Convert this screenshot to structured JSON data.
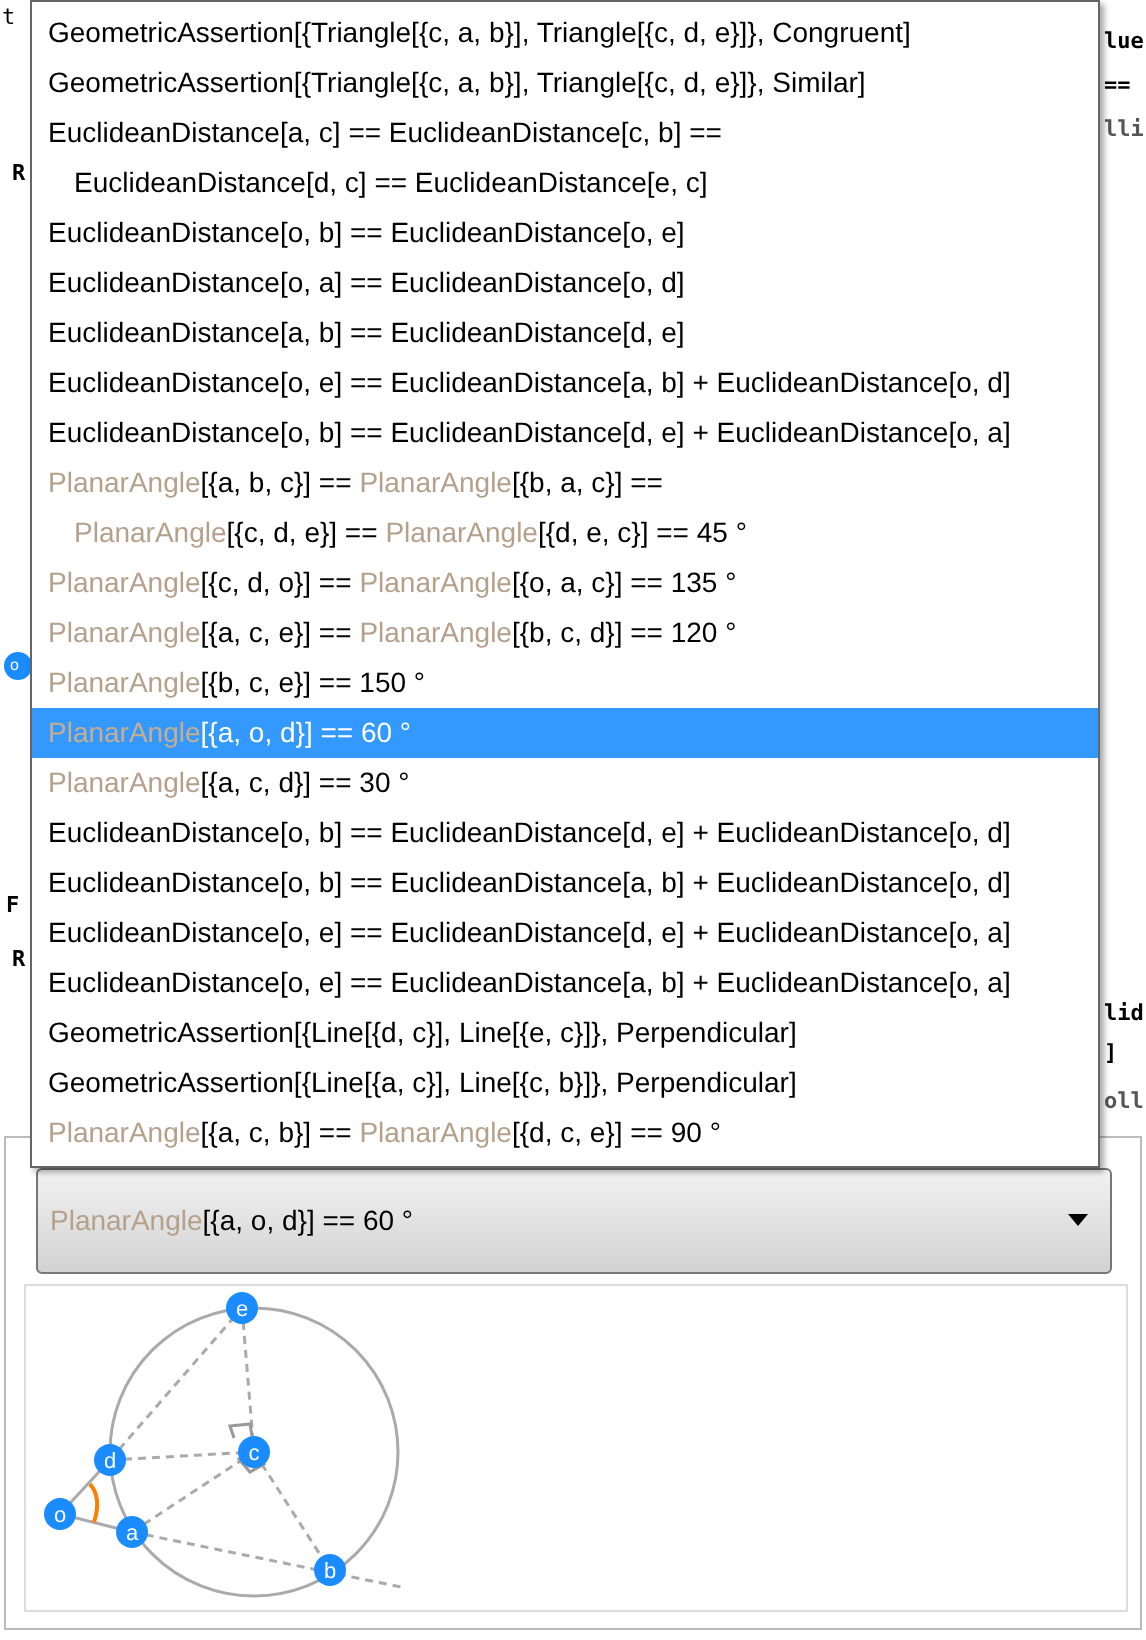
{
  "background_left": [
    "t",
    "R",
    "F",
    "R"
  ],
  "background_right": [
    "lue",
    "==",
    "lli",
    "lid",
    "]",
    "oll"
  ],
  "menu": {
    "items": [
      {
        "selected": false,
        "lines": [
          [
            {
              "kind": "plain",
              "text": "GeometricAssertion[{Triangle[{c, a, b}], Triangle[{c, d, e}]}, Congruent]"
            }
          ]
        ]
      },
      {
        "selected": false,
        "lines": [
          [
            {
              "kind": "plain",
              "text": "GeometricAssertion[{Triangle[{c, a, b}], Triangle[{c, d, e}]}, Similar]"
            }
          ]
        ]
      },
      {
        "selected": false,
        "lines": [
          [
            {
              "kind": "plain",
              "text": "EuclideanDistance[a, c] == EuclideanDistance[c, b] =="
            }
          ],
          [
            {
              "kind": "plain",
              "text": "EuclideanDistance[d, c] == EuclideanDistance[e, c]"
            }
          ]
        ]
      },
      {
        "selected": false,
        "lines": [
          [
            {
              "kind": "plain",
              "text": "EuclideanDistance[o, b] == EuclideanDistance[o, e]"
            }
          ]
        ]
      },
      {
        "selected": false,
        "lines": [
          [
            {
              "kind": "plain",
              "text": "EuclideanDistance[o, a] == EuclideanDistance[o, d]"
            }
          ]
        ]
      },
      {
        "selected": false,
        "lines": [
          [
            {
              "kind": "plain",
              "text": "EuclideanDistance[a, b] == EuclideanDistance[d, e]"
            }
          ]
        ]
      },
      {
        "selected": false,
        "lines": [
          [
            {
              "kind": "plain",
              "text": "EuclideanDistance[o, e] == EuclideanDistance[a, b] + EuclideanDistance[o, d]"
            }
          ]
        ]
      },
      {
        "selected": false,
        "lines": [
          [
            {
              "kind": "plain",
              "text": "EuclideanDistance[o, b] == EuclideanDistance[d, e] + EuclideanDistance[o, a]"
            }
          ]
        ]
      },
      {
        "selected": false,
        "lines": [
          [
            {
              "kind": "head",
              "text": "PlanarAngle"
            },
            {
              "kind": "plain",
              "text": "[{a, b, c}] == "
            },
            {
              "kind": "head",
              "text": "PlanarAngle"
            },
            {
              "kind": "plain",
              "text": "[{b, a, c}] =="
            }
          ],
          [
            {
              "kind": "head",
              "text": "PlanarAngle"
            },
            {
              "kind": "plain",
              "text": "[{c, d, e}] == "
            },
            {
              "kind": "head",
              "text": "PlanarAngle"
            },
            {
              "kind": "plain",
              "text": "[{d, e, c}] == 45 °"
            }
          ]
        ]
      },
      {
        "selected": false,
        "lines": [
          [
            {
              "kind": "head",
              "text": "PlanarAngle"
            },
            {
              "kind": "plain",
              "text": "[{c, d, o}] == "
            },
            {
              "kind": "head",
              "text": "PlanarAngle"
            },
            {
              "kind": "plain",
              "text": "[{o, a, c}] == 135 °"
            }
          ]
        ]
      },
      {
        "selected": false,
        "lines": [
          [
            {
              "kind": "head",
              "text": "PlanarAngle"
            },
            {
              "kind": "plain",
              "text": "[{a, c, e}] == "
            },
            {
              "kind": "head",
              "text": "PlanarAngle"
            },
            {
              "kind": "plain",
              "text": "[{b, c, d}] == 120 °"
            }
          ]
        ]
      },
      {
        "selected": false,
        "lines": [
          [
            {
              "kind": "head",
              "text": "PlanarAngle"
            },
            {
              "kind": "plain",
              "text": "[{b, c, e}] == 150 °"
            }
          ]
        ]
      },
      {
        "selected": true,
        "lines": [
          [
            {
              "kind": "head",
              "text": "PlanarAngle"
            },
            {
              "kind": "plain",
              "text": "[{a, o, d}] == 60 °"
            }
          ]
        ]
      },
      {
        "selected": false,
        "lines": [
          [
            {
              "kind": "head",
              "text": "PlanarAngle"
            },
            {
              "kind": "plain",
              "text": "[{a, c, d}] == 30 °"
            }
          ]
        ]
      },
      {
        "selected": false,
        "lines": [
          [
            {
              "kind": "plain",
              "text": "EuclideanDistance[o, b] == EuclideanDistance[d, e] + EuclideanDistance[o, d]"
            }
          ]
        ]
      },
      {
        "selected": false,
        "lines": [
          [
            {
              "kind": "plain",
              "text": "EuclideanDistance[o, b] == EuclideanDistance[a, b] + EuclideanDistance[o, d]"
            }
          ]
        ]
      },
      {
        "selected": false,
        "lines": [
          [
            {
              "kind": "plain",
              "text": "EuclideanDistance[o, e] == EuclideanDistance[d, e] + EuclideanDistance[o, a]"
            }
          ]
        ]
      },
      {
        "selected": false,
        "lines": [
          [
            {
              "kind": "plain",
              "text": "EuclideanDistance[o, e] == EuclideanDistance[a, b] + EuclideanDistance[o, a]"
            }
          ]
        ]
      },
      {
        "selected": false,
        "lines": [
          [
            {
              "kind": "plain",
              "text": "GeometricAssertion[{Line[{d, c}], Line[{e, c}]}, Perpendicular]"
            }
          ]
        ]
      },
      {
        "selected": false,
        "lines": [
          [
            {
              "kind": "plain",
              "text": "GeometricAssertion[{Line[{a, c}], Line[{c, b}]}, Perpendicular]"
            }
          ]
        ]
      },
      {
        "selected": false,
        "lines": [
          [
            {
              "kind": "head",
              "text": "PlanarAngle"
            },
            {
              "kind": "plain",
              "text": "[{a, c, b}] == "
            },
            {
              "kind": "head",
              "text": "PlanarAngle"
            },
            {
              "kind": "plain",
              "text": "[{d, c, e}] == 90 °"
            }
          ]
        ]
      }
    ]
  },
  "popup": {
    "value": [
      {
        "kind": "head",
        "text": "PlanarAngle"
      },
      {
        "kind": "plain",
        "text": "[{a, o, d}] == 60 °"
      }
    ]
  },
  "diagram": {
    "hidden_point_label": "o",
    "points": [
      {
        "label": "e"
      },
      {
        "label": "c"
      },
      {
        "label": "d"
      },
      {
        "label": "o"
      },
      {
        "label": "a"
      },
      {
        "label": "b"
      }
    ]
  }
}
